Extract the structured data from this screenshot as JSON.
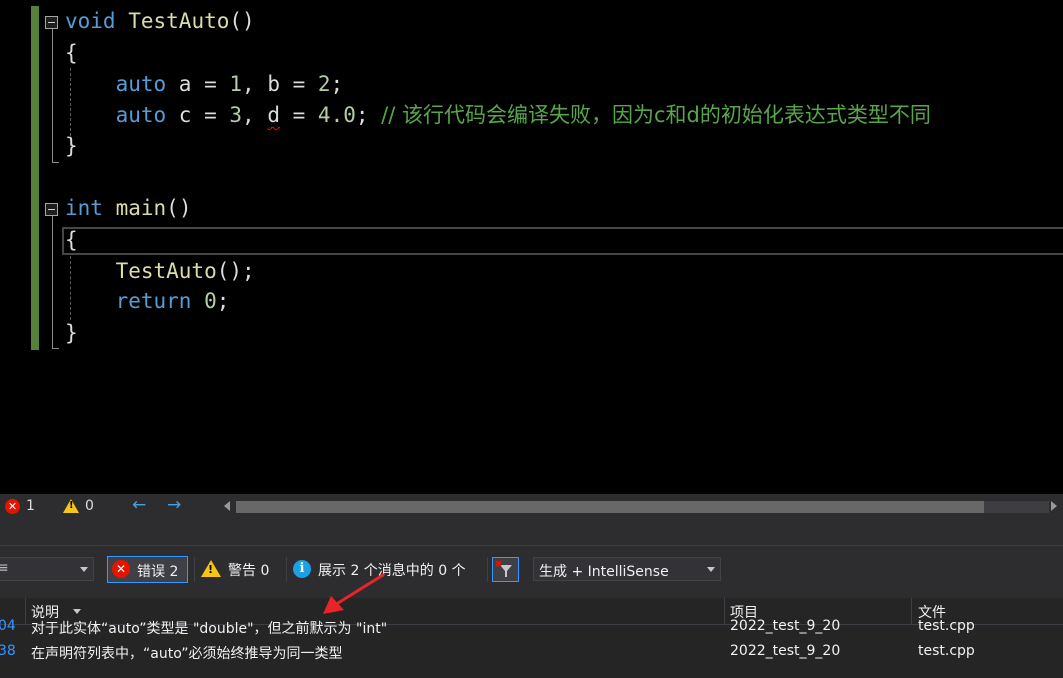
{
  "editor": {
    "f1_kw": "void",
    "f1_name": "TestAuto",
    "f1_parens": "()",
    "brace_open": "{",
    "brace_close": "}",
    "l3_kw": "auto",
    "l3_rest": " a = ",
    "l3_n1": "1",
    "l3_mid": ", b = ",
    "l3_n2": "2",
    "l3_end": ";",
    "l4_kw": "auto",
    "l4_rest": " c = ",
    "l4_n1": "3",
    "l4_mid": ", ",
    "l4_d": "d",
    "l4_eq": " = ",
    "l4_n2": "4.0",
    "l4_end": "; ",
    "l4_comment": "// 该行代码会编译失败，因为c和d的初始化表达式类型不同",
    "f2_kw": "int",
    "f2_name": "main",
    "f2_parens": "()",
    "l9_call": "TestAuto",
    "l9_end": "();",
    "l10_kw": "return",
    "l10_sp": " ",
    "l10_num": "0",
    "l10_end": ";"
  },
  "status": {
    "error_count": "1",
    "warning_count": "0",
    "back_arrow": "←",
    "forward_arrow": "→"
  },
  "toolbar": {
    "scope_value": "≡",
    "errors_label": "错误 2",
    "warnings_label": "警告 0",
    "messages_label": "展示 2 个消息中的 0 个",
    "build_filter": "生成 + IntelliSense"
  },
  "list": {
    "columns": {
      "description": "说明",
      "project": "项目",
      "file": "文件"
    },
    "rows": [
      {
        "code": "04",
        "description": "对于此实体“auto”类型是 \"double\"，但之前默示为 \"int\"",
        "project": "2022_test_9_20",
        "file": "test.cpp"
      },
      {
        "code": "38",
        "description": "在声明符列表中，“auto”必须始终推导为同一类型",
        "project": "2022_test_9_20",
        "file": "test.cpp"
      }
    ]
  },
  "colors": {
    "keyword": "#569cd6",
    "function": "#dcdcaa",
    "number": "#b5cea8",
    "comment": "#57a64a",
    "error": "#e51400",
    "accent": "#3399ff",
    "annotation_arrow": "#e8242a"
  }
}
